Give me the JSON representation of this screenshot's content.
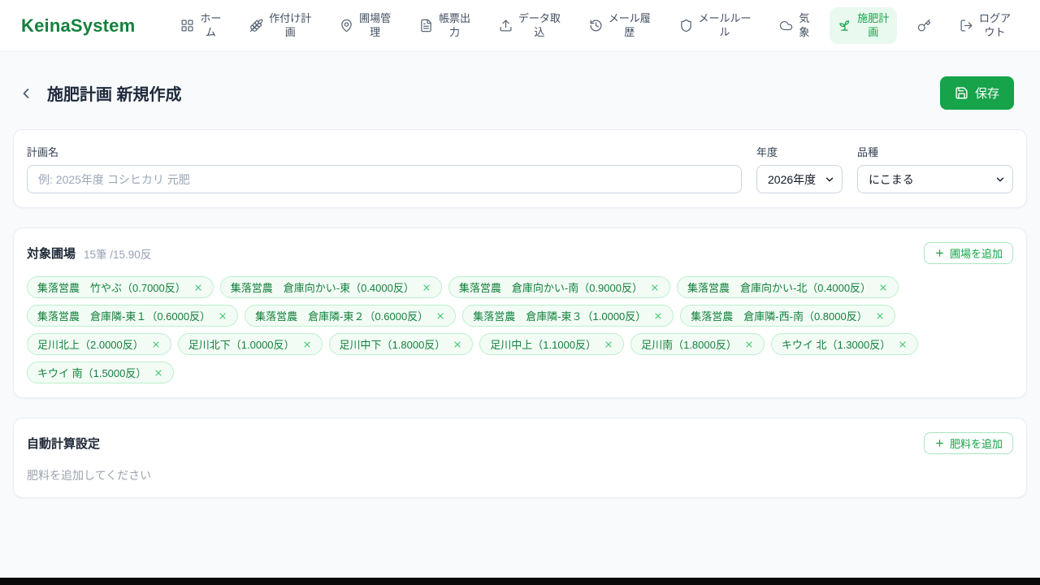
{
  "brand": {
    "name": "KeinaSystem"
  },
  "nav": {
    "items": [
      {
        "id": "home",
        "label": "ホーム",
        "lines": "ホー\nム",
        "icon": "grid",
        "active": false
      },
      {
        "id": "planting",
        "label": "作付け計画",
        "lines": "作付け計\n画",
        "icon": "wheat",
        "active": false
      },
      {
        "id": "fields",
        "label": "圃場管理",
        "lines": "圃場管\n理",
        "icon": "map-pin",
        "active": false
      },
      {
        "id": "reports",
        "label": "帳票出力",
        "lines": "帳票出\n力",
        "icon": "file-text",
        "active": false
      },
      {
        "id": "import",
        "label": "データ取込",
        "lines": "データ取\n込",
        "icon": "upload",
        "active": false
      },
      {
        "id": "mail-history",
        "label": "メール履歴",
        "lines": "メール履\n歴",
        "icon": "history",
        "active": false
      },
      {
        "id": "mail-rules",
        "label": "メールルール",
        "lines": "メールルー\nル",
        "icon": "shield",
        "active": false
      },
      {
        "id": "weather",
        "label": "気象",
        "lines": "気\n象",
        "icon": "cloud",
        "active": false
      },
      {
        "id": "fertilization",
        "label": "施肥計画",
        "lines": "施肥計\n画",
        "icon": "sprout",
        "active": true
      },
      {
        "id": "key",
        "label": "",
        "lines": "",
        "icon": "key",
        "active": false
      },
      {
        "id": "logout",
        "label": "ログアウト",
        "lines": "ログア\nウト",
        "icon": "log-out",
        "active": false
      }
    ]
  },
  "page": {
    "title": "施肥計画 新規作成",
    "save_label": "保存"
  },
  "form": {
    "plan_name": {
      "label": "計画名",
      "placeholder": "例: 2025年度 コシヒカリ 元肥",
      "value": ""
    },
    "year": {
      "label": "年度",
      "value": "2026年度"
    },
    "variety": {
      "label": "品種",
      "value": "にこまる"
    }
  },
  "target_fields": {
    "title": "対象圃場",
    "summary": "15筆 /15.90反",
    "add_button_label": "圃場を追加",
    "chips": [
      "集落営農　竹やぶ（0.7000反）",
      "集落営農　倉庫向かい-東（0.4000反）",
      "集落営農　倉庫向かい-南（0.9000反）",
      "集落営農　倉庫向かい-北（0.4000反）",
      "集落営農　倉庫隣-東１（0.6000反）",
      "集落営農　倉庫隣-東２（0.6000反）",
      "集落営農　倉庫隣-東３（1.0000反）",
      "集落営農　倉庫隣-西-南（0.8000反）",
      "足川北上（2.0000反）",
      "足川北下（1.0000反）",
      "足川中下（1.8000反）",
      "足川中上（1.1000反）",
      "足川南（1.8000反）",
      "キウイ 北（1.3000反）",
      "キウイ 南（1.5000反）"
    ]
  },
  "auto_calc": {
    "title": "自動計算設定",
    "add_button_label": "肥料を追加",
    "empty_text": "肥料を追加してください"
  },
  "colors": {
    "accent": "#16a34a",
    "accent_dark": "#15803d",
    "chip_bg": "#f2fcf5",
    "chip_border": "#bcf0cd",
    "active_nav_bg": "#e9f9ef",
    "page_bg": "#f8fafc"
  }
}
